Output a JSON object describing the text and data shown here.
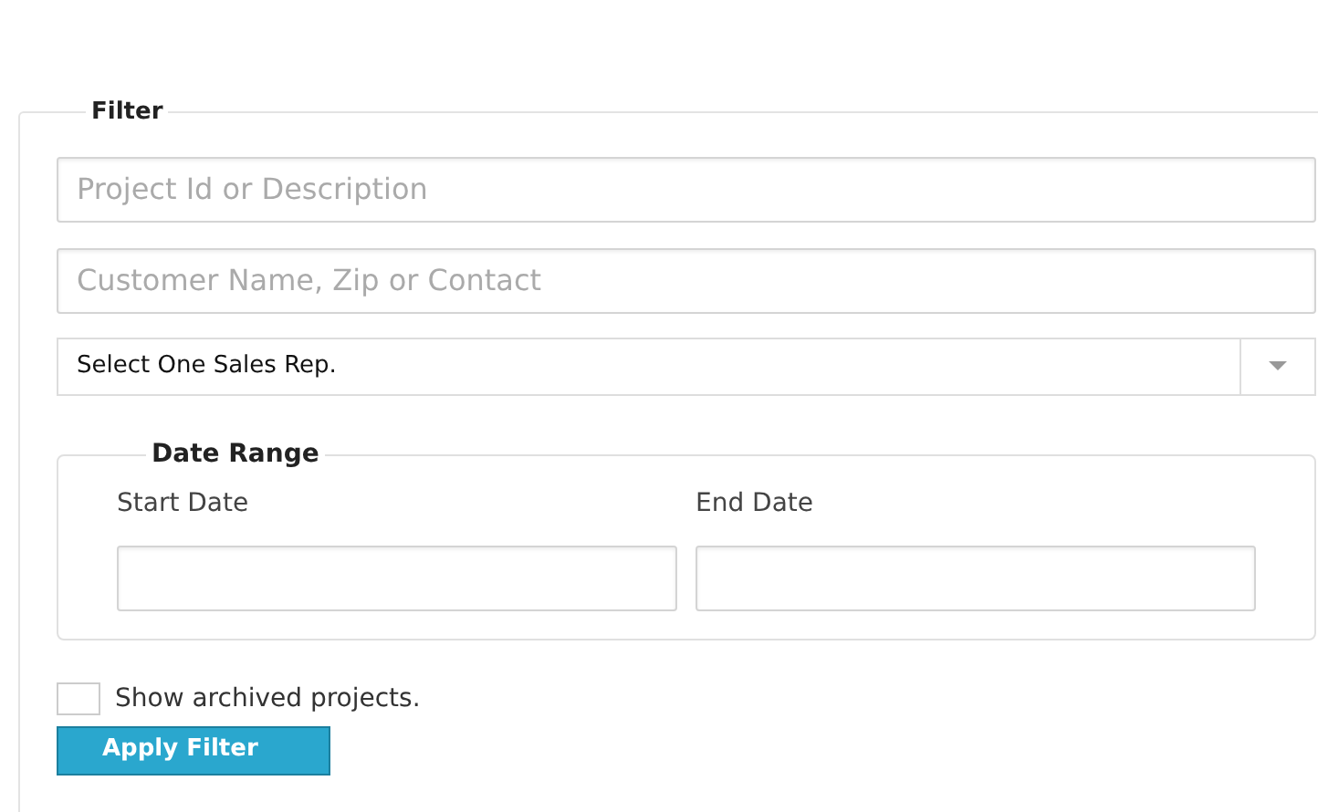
{
  "filter": {
    "legend": "Filter",
    "project_field": {
      "placeholder": "Project Id or Description"
    },
    "customer_field": {
      "placeholder": "Customer Name, Zip or Contact"
    },
    "sales_rep_select": {
      "value": "Select One Sales Rep."
    },
    "date_range": {
      "legend": "Date Range",
      "start_label": "Start Date",
      "end_label": "End Date"
    },
    "show_archived": {
      "label": "Show archived projects.",
      "checked": false
    },
    "apply_button": "Apply Filter"
  }
}
